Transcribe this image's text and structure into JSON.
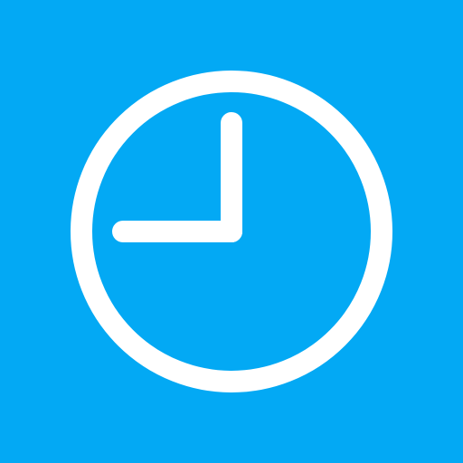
{
  "icon": {
    "name": "clock-icon",
    "background_color": "#03A9F4",
    "foreground_color": "#FFFFFF",
    "time_shown": "9:00"
  }
}
